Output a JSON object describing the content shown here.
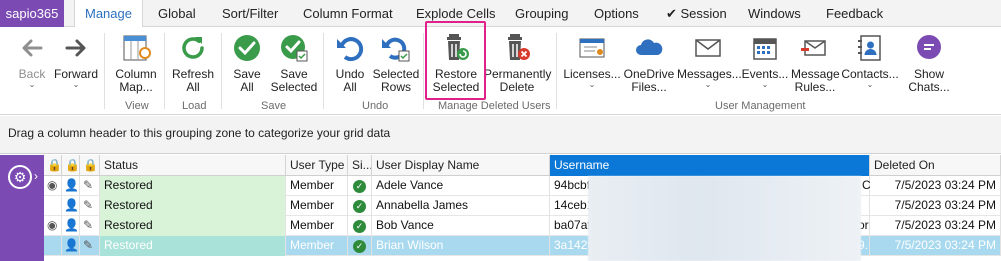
{
  "tabs": {
    "brand": "sapio365",
    "items": [
      "Manage",
      "Global",
      "Sort/Filter",
      "Column Format",
      "Explode Cells",
      "Grouping",
      "Options",
      "✔ Session",
      "Windows",
      "Feedback"
    ]
  },
  "ribbon": {
    "back": "Back",
    "forward": "Forward",
    "column_map_1": "Column",
    "column_map_2": "Map...",
    "refresh_1": "Refresh",
    "refresh_2": "All",
    "save_all_1": "Save",
    "save_all_2": "All",
    "save_sel_1": "Save",
    "save_sel_2": "Selected",
    "undo_all_1": "Undo",
    "undo_all_2": "All",
    "undo_sel_1": "Selected",
    "undo_sel_2": "Rows",
    "restore_1": "Restore",
    "restore_2": "Selected",
    "perm_1": "Permanently",
    "perm_2": "Delete",
    "licenses": "Licenses...",
    "onedrive_1": "OneDrive",
    "onedrive_2": "Files...",
    "messages": "Messages...",
    "events": "Events...",
    "msgrules_1": "Message",
    "msgrules_2": "Rules...",
    "contacts": "Contacts...",
    "chats_1": "Show",
    "chats_2": "Chats...",
    "groups": {
      "view": "View",
      "load": "Load",
      "save": "Save",
      "undo": "Undo",
      "deleted": "Manage Deleted Users",
      "usermgmt": "User Management"
    }
  },
  "groupzone": "Drag a column header to this grouping zone to categorize your grid data",
  "grid": {
    "headers": {
      "status": "Status",
      "user_type": "User Type",
      "si": "Si...",
      "display_name": "User Display Name",
      "username": "Username",
      "deleted_on": "Deleted On"
    },
    "rows": [
      {
        "status": "Restored",
        "user_type": "Member",
        "display_name": "Adele Vance",
        "username": "94bcbf",
        "tail": "C",
        "deleted_on": "7/5/2023 03:24 PM"
      },
      {
        "status": "Restored",
        "user_type": "Member",
        "display_name": "Annabella James",
        "username": "14ceb1",
        "tail": "",
        "deleted_on": "7/5/2023 03:24 PM"
      },
      {
        "status": "Restored",
        "user_type": "Member",
        "display_name": "Bob Vance",
        "username": "ba07af",
        "tail": "or",
        "deleted_on": "7/5/2023 03:24 PM"
      },
      {
        "status": "Restored",
        "user_type": "Member",
        "display_name": "Brian Wilson",
        "username": "3a1429",
        "tail": "9.",
        "deleted_on": "7/5/2023 03:24 PM"
      }
    ]
  },
  "colors": {
    "brand": "#7b4bb3",
    "accent_tab": "#2e6fbf",
    "highlight": "#e0218a",
    "selected_header": "#0b78d7",
    "status_bg": "#d8f3d8",
    "check_green": "#2f8b3c"
  }
}
